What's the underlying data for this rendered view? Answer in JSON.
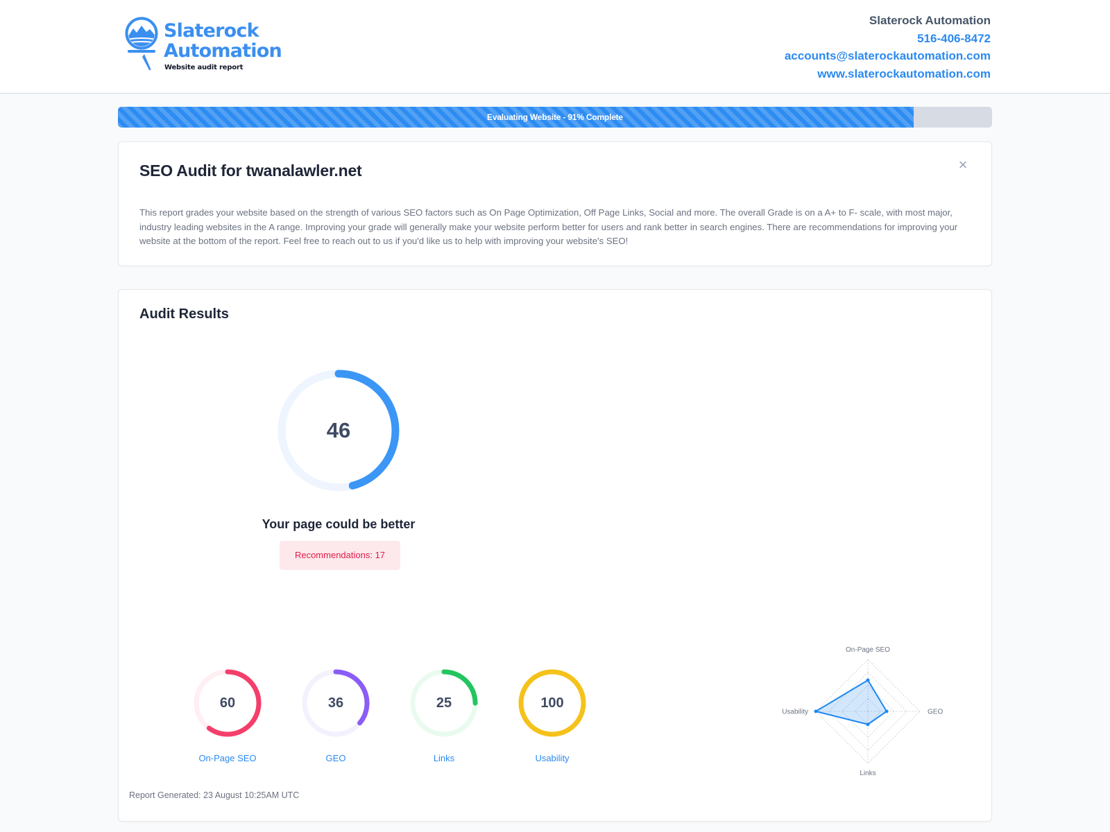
{
  "brand": {
    "line1": "Slaterock",
    "line2": "Automation",
    "tagline": "Website audit report"
  },
  "contact": {
    "company": "Slaterock Automation",
    "phone": "516-406-8472",
    "email": "accounts@slaterockautomation.com",
    "website": "www.slaterockautomation.com"
  },
  "progress": {
    "label": "Evaluating Website - 91% Complete",
    "percent": 91
  },
  "intro": {
    "title": "SEO Audit for twanalawler.net",
    "close_icon": "close-icon",
    "description": "This report grades your website based on the strength of various SEO factors such as On Page Optimization, Off Page Links, Social and more. The overall Grade is on a A+ to F- scale, with most major, industry leading websites in the A range. Improving your grade will generally make your website perform better for users and rank better in search engines. There are recommendations for improving your website at the bottom of the report. Feel free to reach out to us if you'd like us to help with improving your website's SEO!"
  },
  "results": {
    "title": "Audit Results",
    "overall_score": 46,
    "overall_color": "#3b96f5",
    "overall_track": "#eef5fe",
    "verdict": "Your page could be better",
    "recommendations": "Recommendations: 17",
    "categories": [
      {
        "label": "On-Page SEO",
        "score": 60,
        "color": "#f43f6a",
        "track": "#ffeef2"
      },
      {
        "label": "GEO",
        "score": 36,
        "color": "#8b5cf6",
        "track": "#f4f1fe"
      },
      {
        "label": "Links",
        "score": 25,
        "color": "#22c55e",
        "track": "#e9fbef"
      },
      {
        "label": "Usability",
        "score": 100,
        "color": "#f5c21b",
        "track": "#fef6d9"
      }
    ],
    "radar": {
      "axes": [
        "On-Page SEO",
        "GEO",
        "Links",
        "Usability"
      ],
      "values": [
        60,
        36,
        25,
        100
      ],
      "max": 100,
      "color": "#1e88f0"
    },
    "generated": "Report Generated: 23 August 10:25AM UTC"
  }
}
